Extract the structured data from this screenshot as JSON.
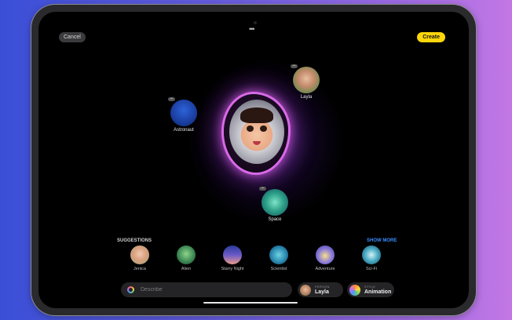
{
  "top_bar": {
    "cancel_label": "Cancel",
    "create_label": "Create",
    "more_icon": "ellipsis-icon"
  },
  "concepts": [
    {
      "label": "Astronaut"
    },
    {
      "label": "Layla"
    },
    {
      "label": "Space"
    }
  ],
  "suggestions": {
    "title": "SUGGESTIONS",
    "show_more": "SHOW MORE",
    "items": [
      {
        "label": "Jenica"
      },
      {
        "label": "Alien"
      },
      {
        "label": "Starry Night"
      },
      {
        "label": "Scientist"
      },
      {
        "label": "Adventure"
      },
      {
        "label": "Sci-Fi"
      }
    ]
  },
  "input": {
    "placeholder": "Describe"
  },
  "person_chip": {
    "caption": "PERSON",
    "value": "Layla"
  },
  "style_chip": {
    "caption": "STYLE",
    "value": "Animation"
  },
  "colors": {
    "accent_create": "#ffd60a",
    "show_more": "#3a8dff",
    "glow": "#d96ae8"
  }
}
